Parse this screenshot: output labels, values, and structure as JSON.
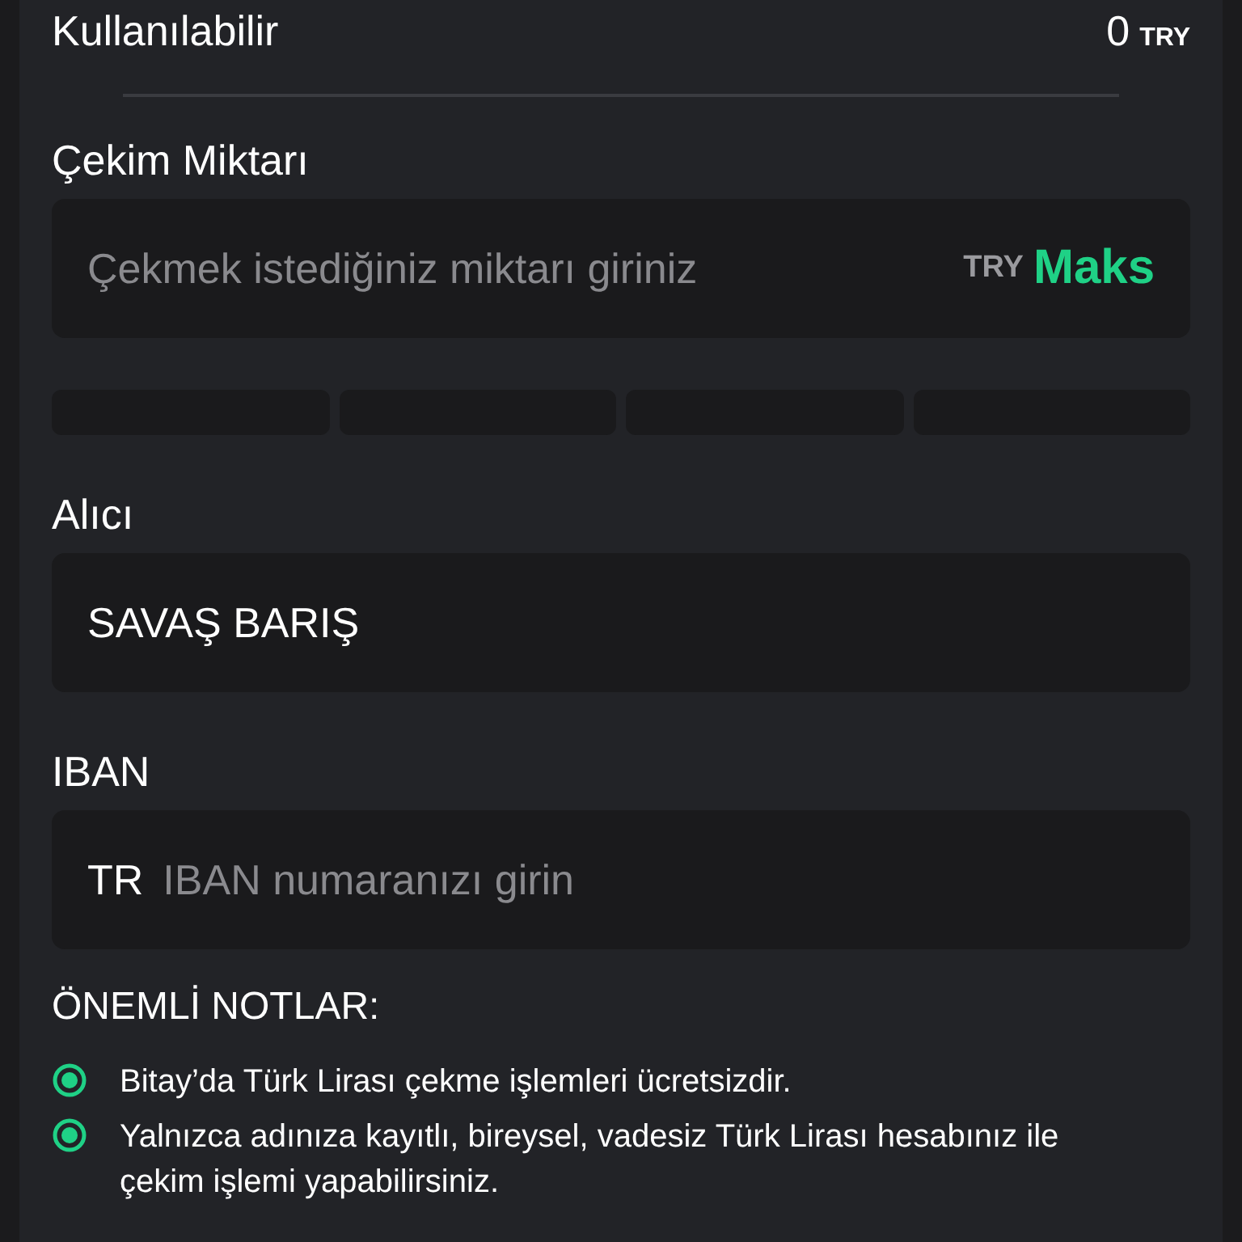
{
  "available": {
    "label": "Kullanılabilir",
    "amount": "0",
    "currency": "TRY"
  },
  "amount_field": {
    "label": "Çekim Miktarı",
    "placeholder": "Çekmek istediğiniz miktarı giriniz",
    "currency": "TRY",
    "max_button": "Maks"
  },
  "quick_amounts": [
    {
      "selected": false
    },
    {
      "selected": false
    },
    {
      "selected": false
    },
    {
      "selected": false
    }
  ],
  "recipient_field": {
    "label": "Alıcı",
    "value": "SAVAŞ BARIŞ"
  },
  "iban_field": {
    "label": "IBAN",
    "prefix": "TR",
    "placeholder": "IBAN numaranızı girin"
  },
  "notes": {
    "title": "ÖNEMLİ NOTLAR:",
    "items": [
      {
        "text": "Bitay’da Türk Lirası çekme işlemleri ücretsizdir."
      },
      {
        "text": "Yalnızca adınıza kayıtlı, bireysel, vadesiz Türk Lirası hesabınız ile çekim işlemi yapabilirsiniz."
      }
    ]
  }
}
